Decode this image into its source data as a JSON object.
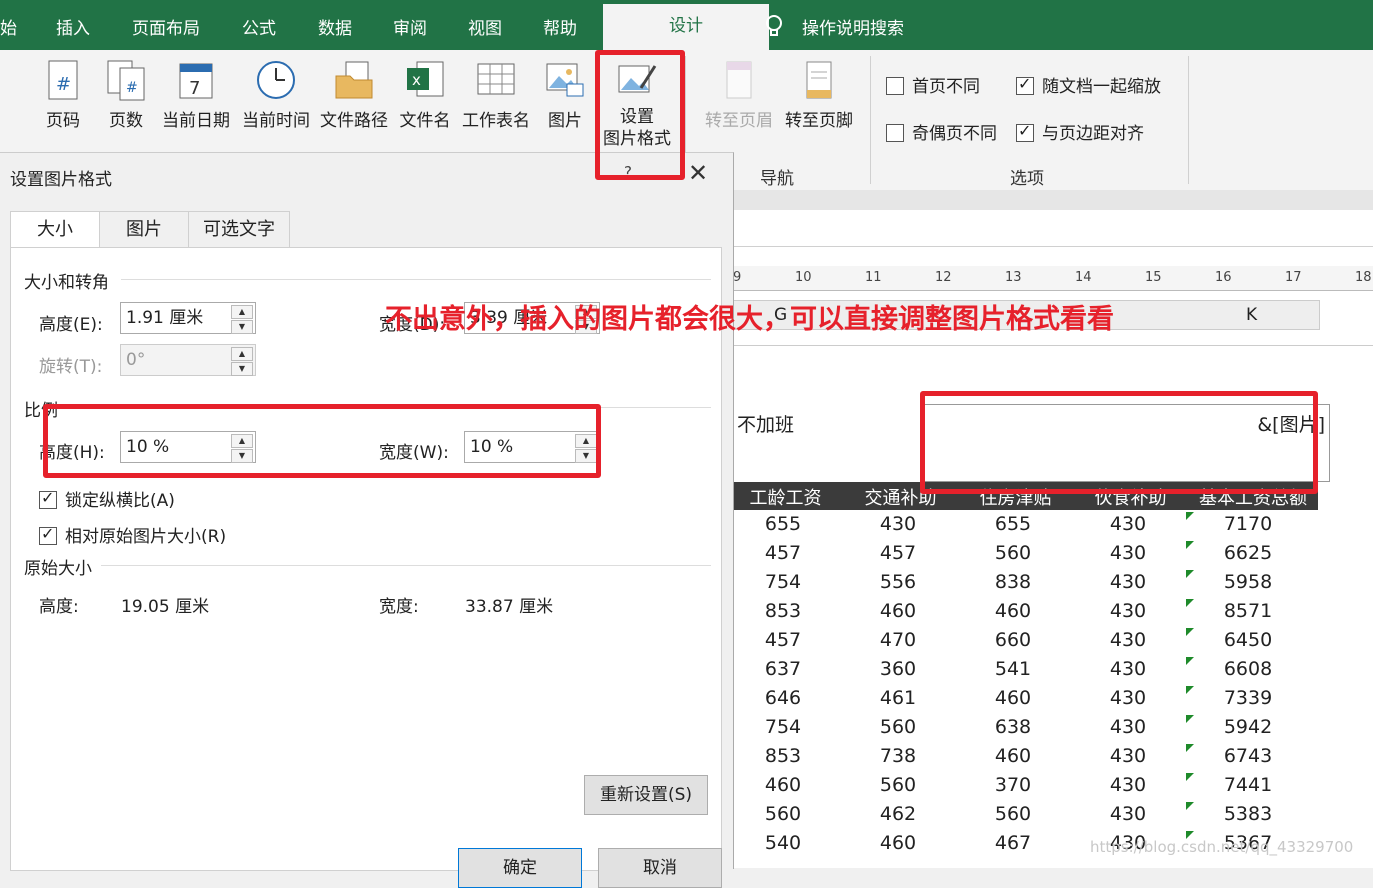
{
  "ribbon_tabs": [
    "始",
    "插入",
    "页面布局",
    "公式",
    "数据",
    "审阅",
    "视图",
    "帮助",
    "设计",
    "操作说明搜索"
  ],
  "ribbon_buttons": {
    "page_number": "页码",
    "page_count": "页数",
    "current_date": "当前日期",
    "current_time": "当前时间",
    "file_path": "文件路径",
    "file_name": "文件名",
    "sheet_name": "工作表名",
    "picture": "图片",
    "format_picture_1": "设置",
    "format_picture_2": "图片格式",
    "goto_header": "转至页眉",
    "goto_footer": "转至页脚"
  },
  "ribbon_groups": {
    "navigation": "导航",
    "options": "选项"
  },
  "options": {
    "diff_first": "首页不同",
    "diff_odd_even": "奇偶页不同",
    "scale_with_doc": "随文档一起缩放",
    "align_margins": "与页边距对齐"
  },
  "dialog": {
    "title": "设置图片格式",
    "help": "?",
    "tabs": [
      "大小",
      "图片",
      "可选文字"
    ],
    "section_size": "大小和转角",
    "height_label": "高度(E):",
    "height_value": "1.91 厘米",
    "width_label": "宽度(D):",
    "width_value": "3.39 厘米",
    "rotate_label": "旋转(T):",
    "rotate_value": "0°",
    "section_scale": "比例",
    "scale_h_label": "高度(H):",
    "scale_h_value": "10 %",
    "scale_w_label": "宽度(W):",
    "scale_w_value": "10 %",
    "lock_ratio": "锁定纵横比(A)",
    "relative_original": "相对原始图片大小(R)",
    "section_original": "原始大小",
    "orig_h_label": "高度:",
    "orig_h_value": "19.05 厘米",
    "orig_w_label": "宽度:",
    "orig_w_value": "33.87 厘米",
    "reset": "重新设置(S)",
    "ok": "确定",
    "cancel": "取消"
  },
  "annotation": "不出意外，插入的图片都会很大，可以直接调整图片格式看看",
  "ruler": [
    "9",
    "10",
    "11",
    "12",
    "13",
    "14",
    "15",
    "16",
    "17",
    "18"
  ],
  "column_header_visible": {
    "g": "G",
    "k": "K"
  },
  "header_left_text": "不加班",
  "header_right_text": "&[图片]",
  "table": {
    "headers": [
      "工龄工资",
      "交通补助",
      "住房津贴",
      "伙食补助",
      "基本工资总额"
    ],
    "rows": [
      [
        "655",
        "430",
        "655",
        "430",
        "7170"
      ],
      [
        "457",
        "457",
        "560",
        "430",
        "6625"
      ],
      [
        "754",
        "556",
        "838",
        "430",
        "5958"
      ],
      [
        "853",
        "460",
        "460",
        "430",
        "8571"
      ],
      [
        "457",
        "470",
        "660",
        "430",
        "6450"
      ],
      [
        "637",
        "360",
        "541",
        "430",
        "6608"
      ],
      [
        "646",
        "461",
        "460",
        "430",
        "7339"
      ],
      [
        "754",
        "560",
        "638",
        "430",
        "5942"
      ],
      [
        "853",
        "738",
        "460",
        "430",
        "6743"
      ],
      [
        "460",
        "560",
        "370",
        "430",
        "7441"
      ],
      [
        "560",
        "462",
        "560",
        "430",
        "5383"
      ],
      [
        "540",
        "460",
        "467",
        "430",
        "5367"
      ]
    ]
  },
  "watermark": "https://blog.csdn.net/qq_43329700",
  "colors": {
    "excel_green": "#217346",
    "red": "#e6212b"
  }
}
